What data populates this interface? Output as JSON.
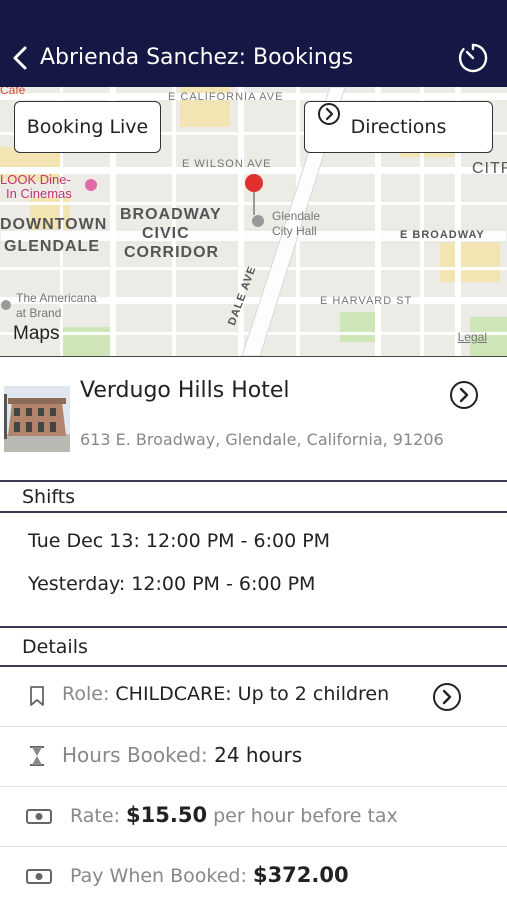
{
  "header": {
    "title": "Abrienda Sanchez: Bookings"
  },
  "map": {
    "buttons": {
      "booking_live": "Booking Live",
      "directions": "Directions"
    },
    "labels": {
      "e_california_ave": "E CALIFORNIA AVE",
      "e_wilson_ave": "E WILSON AVE",
      "e_broadway": "E BROADWAY",
      "e_harvard_st": "E HARVARD ST",
      "downtown": "DOWNTOWN",
      "glendale": "GLENDALE",
      "broadway": "BROADWAY",
      "civic": "CIVIC",
      "corridor": "CORRIDOR",
      "look_line1": "LOOK Dine-",
      "look_line2": "In Cinemas",
      "city_hall_line1": "Glendale",
      "city_hall_line2": "City Hall",
      "americana_line1": "The Americana",
      "americana_line2": "at Brand",
      "citr": "CITR",
      "cafe": "Cafe",
      "dale_ave": "DALE AVE"
    },
    "attribution": "Maps",
    "legal": "Legal"
  },
  "hotel": {
    "name": "Verdugo Hills Hotel",
    "address": "613 E. Broadway, Glendale, California, 91206"
  },
  "shifts": {
    "heading": "Shifts",
    "items": [
      "Tue Dec 13: 12:00 PM - 6:00 PM",
      "Yesterday: 12:00 PM - 6:00 PM"
    ]
  },
  "details": {
    "heading": "Details",
    "role_label": "Role:",
    "role_value": "CHILDCARE: Up to 2 children",
    "hours_label": "Hours Booked:",
    "hours_value": "24 hours",
    "rate_label": "Rate:",
    "rate_value": "$15.50",
    "rate_suffix": "per hour before tax",
    "pay_label": "Pay When Booked:",
    "pay_value": "$372.00"
  },
  "colors": {
    "header_bg": "#151745",
    "pin": "#e03030"
  }
}
